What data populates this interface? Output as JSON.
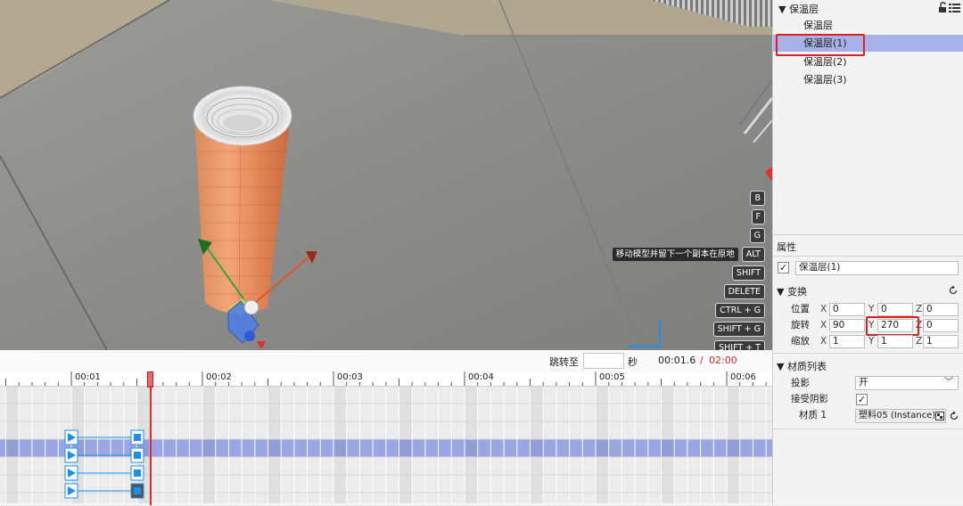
{
  "viewport": {
    "hotkeys": [
      "B",
      "F",
      "G",
      "ALT",
      "SHIFT",
      "DELETE",
      "CTRL + G",
      "SHIFT + G",
      "SHIFT + T"
    ],
    "alt_tooltip": "移动模型并留下一个副本在原地"
  },
  "hierarchy": {
    "root_label": "保温层",
    "items": [
      "保温层",
      "保温层(1)",
      "保温层(2)",
      "保温层(3)"
    ],
    "selected_index": 1
  },
  "properties": {
    "header": "属性",
    "object_name": "保温层(1)",
    "object_enabled": true,
    "transform": {
      "title": "变换",
      "position_label": "位置",
      "rotation_label": "旋转",
      "scale_label": "缩放",
      "axis_x": "X",
      "axis_y": "Y",
      "axis_z": "Z",
      "position": [
        "0",
        "0",
        "0"
      ],
      "rotation": [
        "90",
        "270",
        "0"
      ],
      "scale": [
        "1",
        "1",
        "1"
      ]
    },
    "materials": {
      "title": "材质列表",
      "shadow_label": "投影",
      "shadow_value": "开",
      "receive_shadow_label": "接受阴影",
      "receive_shadow": true,
      "material_label": "材质 1",
      "material_value": "塑料05 (Instance)"
    }
  },
  "timeline": {
    "jump_label": "跳转至",
    "jump_value": "",
    "seconds_unit": "秒",
    "current_time": "00:01.6",
    "separator": "/",
    "total_time": "02:00",
    "ruler_labels": [
      "00:01",
      "00:02",
      "00:03",
      "00:04",
      "00:05",
      "00:06"
    ],
    "colors": {
      "playhead": "#e0262a",
      "total_time": "#e0262a",
      "selected_track": "#9aa6e4",
      "key": "#1e8ef0"
    }
  }
}
